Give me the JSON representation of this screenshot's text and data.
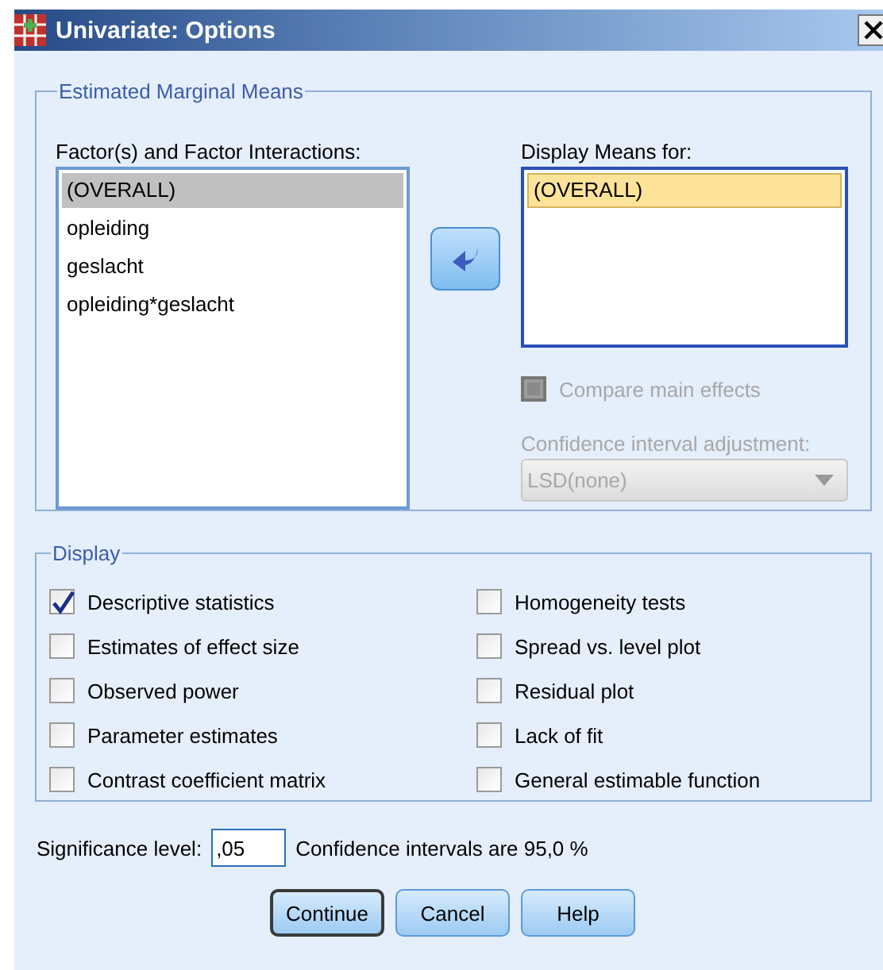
{
  "window": {
    "title": "Univariate: Options"
  },
  "estimated_marginal_means": {
    "title": "Estimated Marginal Means",
    "factors": {
      "label": "Factor(s) and Factor Interactions:",
      "items": [
        {
          "label": "(OVERALL)",
          "selected": true
        },
        {
          "label": "opleiding",
          "selected": false
        },
        {
          "label": "geslacht",
          "selected": false
        },
        {
          "label": "opleiding*geslacht",
          "selected": false
        }
      ]
    },
    "display_means": {
      "label": "Display Means for:",
      "items": [
        {
          "label": "(OVERALL)",
          "selected": true
        }
      ]
    },
    "compare_main_effects": {
      "label": "Compare main effects",
      "checked": false,
      "disabled": true
    },
    "ci_adjustment": {
      "label": "Confidence interval adjustment:",
      "value": "LSD(none)",
      "disabled": true
    }
  },
  "display": {
    "title": "Display",
    "columns": [
      [
        {
          "label": "Descriptive statistics",
          "checked": true
        },
        {
          "label": "Estimates of effect size",
          "checked": false
        },
        {
          "label": "Observed power",
          "checked": false
        },
        {
          "label": "Parameter estimates",
          "checked": false
        },
        {
          "label": "Contrast coefficient matrix",
          "checked": false
        }
      ],
      [
        {
          "label": "Homogeneity tests",
          "checked": false
        },
        {
          "label": "Spread vs. level plot",
          "checked": false
        },
        {
          "label": "Residual plot",
          "checked": false
        },
        {
          "label": "Lack of fit",
          "checked": false
        },
        {
          "label": "General estimable function",
          "checked": false
        }
      ]
    ]
  },
  "significance": {
    "label": "Significance level:",
    "value": ",05",
    "note": "Confidence intervals are 95,0 %"
  },
  "buttons": [
    {
      "label": "Continue",
      "default": true
    },
    {
      "label": "Cancel",
      "default": false
    },
    {
      "label": "Help",
      "default": false
    }
  ]
}
